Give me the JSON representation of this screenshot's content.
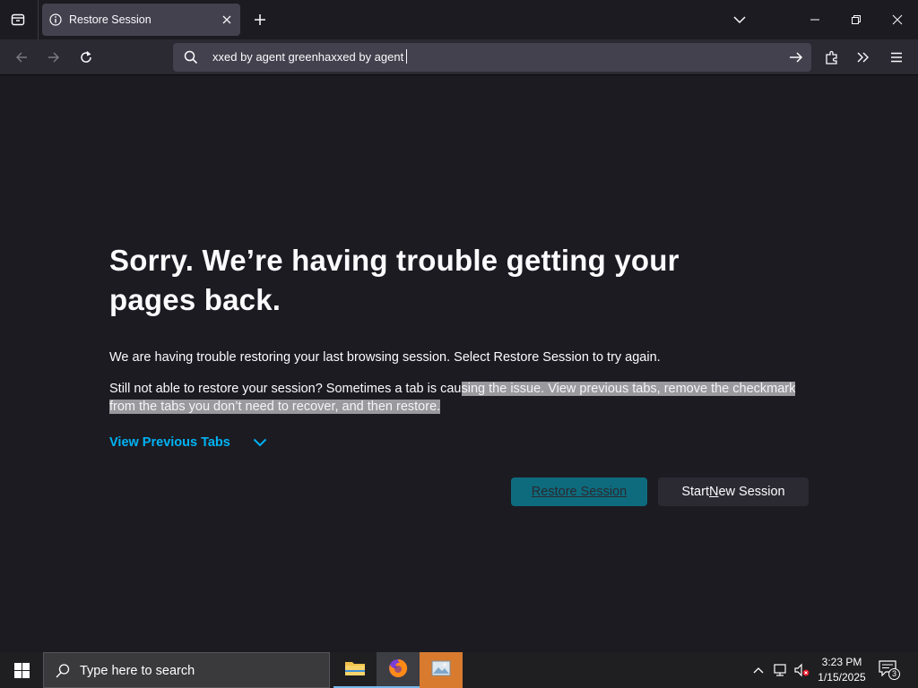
{
  "browser": {
    "tab": {
      "title": "Restore Session"
    },
    "urlbar": {
      "value": "xxed by agent greenhaxxed by agent"
    }
  },
  "page": {
    "title": "Sorry. We’re having trouble getting your pages back.",
    "para1": "We are having trouble restoring your last browsing session. Select Restore Session to try again.",
    "para2_plain": "Still not able to restore your session? Sometimes a tab is cau",
    "para2_selected": "sing the issue. View previous tabs, remove the checkmark from the tabs you don’t need to recover, and then restore.",
    "view_tabs_label": "View Previous Tabs",
    "restore_button": {
      "prefix": "",
      "accel": "R",
      "rest": "estore Session"
    },
    "new_session_button": {
      "prefix": "Start ",
      "accel": "N",
      "rest": "ew Session"
    }
  },
  "taskbar": {
    "search_placeholder": "Type here to search",
    "apps": [
      {
        "name": "file-explorer",
        "icon": "folder-icon"
      },
      {
        "name": "firefox",
        "icon": "firefox-icon"
      },
      {
        "name": "photos",
        "icon": "image-viewer-icon"
      }
    ],
    "clock": {
      "time": "3:23 PM",
      "date": "1/15/2025"
    },
    "notifications_count": "3"
  },
  "colors": {
    "accent_link": "#00b3f4",
    "primary_button": "#0e6b7e",
    "page_bg": "#1c1b22",
    "toolbar_bg": "#2b2a33"
  }
}
